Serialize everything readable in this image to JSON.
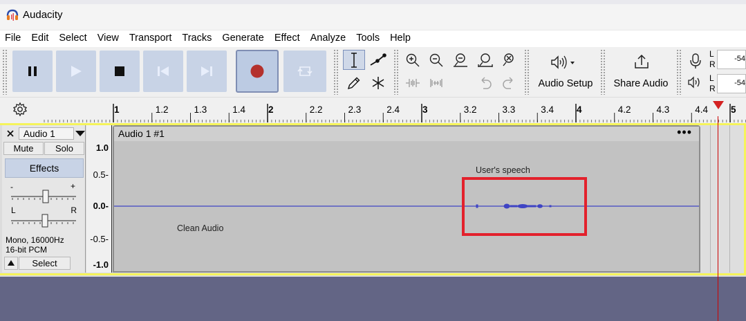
{
  "window": {
    "title": "Audacity"
  },
  "menu": [
    "File",
    "Edit",
    "Select",
    "View",
    "Transport",
    "Tracks",
    "Generate",
    "Effect",
    "Analyze",
    "Tools",
    "Help"
  ],
  "toolbar": {
    "audio_setup_label": "Audio Setup",
    "share_audio_label": "Share Audio",
    "meters": {
      "rec_l": "L",
      "rec_r": "R",
      "rec_value": "-54",
      "play_l": "L",
      "play_r": "R",
      "play_value": "-54"
    }
  },
  "ruler": {
    "labels": [
      "1",
      "1.2",
      "1.3",
      "1.4",
      "2",
      "2.2",
      "2.3",
      "2.4",
      "3",
      "3.2",
      "3.3",
      "3.4",
      "4",
      "4.2",
      "4.3",
      "4.4",
      "5"
    ],
    "major_labels": [
      "1",
      "2",
      "3",
      "4",
      "5"
    ]
  },
  "track": {
    "name": "Audio 1",
    "mute_label": "Mute",
    "solo_label": "Solo",
    "effects_label": "Effects",
    "gain_minus": "-",
    "gain_plus": "+",
    "pan_left": "L",
    "pan_right": "R",
    "format_line1": "Mono, 16000Hz",
    "format_line2": "16-bit PCM",
    "select_label": "Select",
    "clip_name": "Audio 1 #1",
    "clip_menu": "•••",
    "vruler": [
      "1.0",
      "0.5-",
      "0.0-",
      "-0.5-",
      "-1.0"
    ]
  },
  "annotations": {
    "clean_audio": "Clean Audio",
    "users_speech": "User's speech"
  },
  "colors": {
    "record": "#b4312d",
    "waveform": "#3f44c4",
    "highlight_box": "#e3212c",
    "playhead": "#d42222"
  }
}
